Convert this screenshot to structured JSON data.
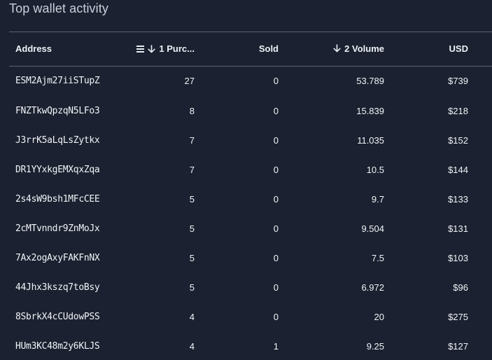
{
  "title": "Top wallet activity",
  "columns": {
    "address": "Address",
    "purchased": "1 Purc...",
    "sold": "Sold",
    "volume": "2 Volume",
    "usd": "USD"
  },
  "rows": [
    {
      "address": "ESM2Ajm27iiSTupZ",
      "purchased": "27",
      "sold": "0",
      "volume": "53.789",
      "usd": "$739"
    },
    {
      "address": "FNZTkwQpzqN5LFo3",
      "purchased": "8",
      "sold": "0",
      "volume": "15.839",
      "usd": "$218"
    },
    {
      "address": "J3rrK5aLqLsZytkx",
      "purchased": "7",
      "sold": "0",
      "volume": "11.035",
      "usd": "$152"
    },
    {
      "address": "DR1YYxkgEMXqxZqa",
      "purchased": "7",
      "sold": "0",
      "volume": "10.5",
      "usd": "$144"
    },
    {
      "address": "2s4sW9bsh1MFcCEE",
      "purchased": "5",
      "sold": "0",
      "volume": "9.7",
      "usd": "$133"
    },
    {
      "address": "2cMTvnndr9ZnMoJx",
      "purchased": "5",
      "sold": "0",
      "volume": "9.504",
      "usd": "$131"
    },
    {
      "address": "7Ax2ogAxyFAKFnNX",
      "purchased": "5",
      "sold": "0",
      "volume": "7.5",
      "usd": "$103"
    },
    {
      "address": "44Jhx3kszq7toBsy",
      "purchased": "5",
      "sold": "0",
      "volume": "6.972",
      "usd": "$96"
    },
    {
      "address": "8SbrkX4cCUdowPSS",
      "purchased": "4",
      "sold": "0",
      "volume": "20",
      "usd": "$275"
    },
    {
      "address": "HUm3KC48m2y6KLJS",
      "purchased": "4",
      "sold": "1",
      "volume": "9.25",
      "usd": "$127"
    }
  ],
  "icons": {
    "menu": "menu-icon",
    "sort_down": "arrow-down-icon"
  }
}
